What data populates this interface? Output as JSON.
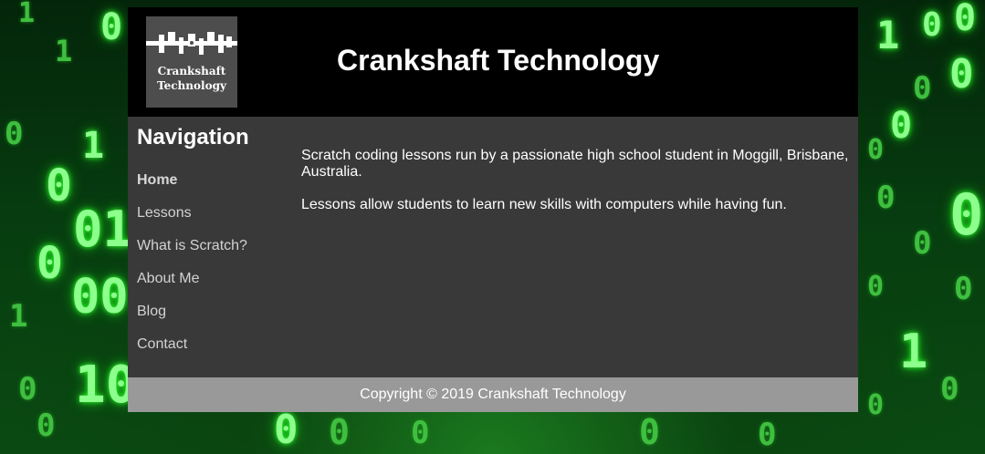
{
  "header": {
    "logo_line1": "Crankshaft",
    "logo_line2": "Technology",
    "title": "Crankshaft Technology"
  },
  "nav": {
    "heading": "Navigation",
    "items": [
      {
        "label": "Home",
        "active": true
      },
      {
        "label": "Lessons",
        "active": false
      },
      {
        "label": "What is Scratch?",
        "active": false
      },
      {
        "label": "About Me",
        "active": false
      },
      {
        "label": "Blog",
        "active": false
      },
      {
        "label": "Contact",
        "active": false
      }
    ]
  },
  "main": {
    "paragraph1": "Scratch coding lessons run by a passionate high school student in Moggill, Brisbane, Australia.",
    "paragraph2": "Lessons allow students to learn new skills with computers while having fun."
  },
  "footer": {
    "copyright": "Copyright © 2019 Crankshaft Technology"
  },
  "colors": {
    "header_bg": "#000000",
    "body_bg": "#393939",
    "footer_bg": "#999999",
    "background_accent": "#2bff2b"
  }
}
